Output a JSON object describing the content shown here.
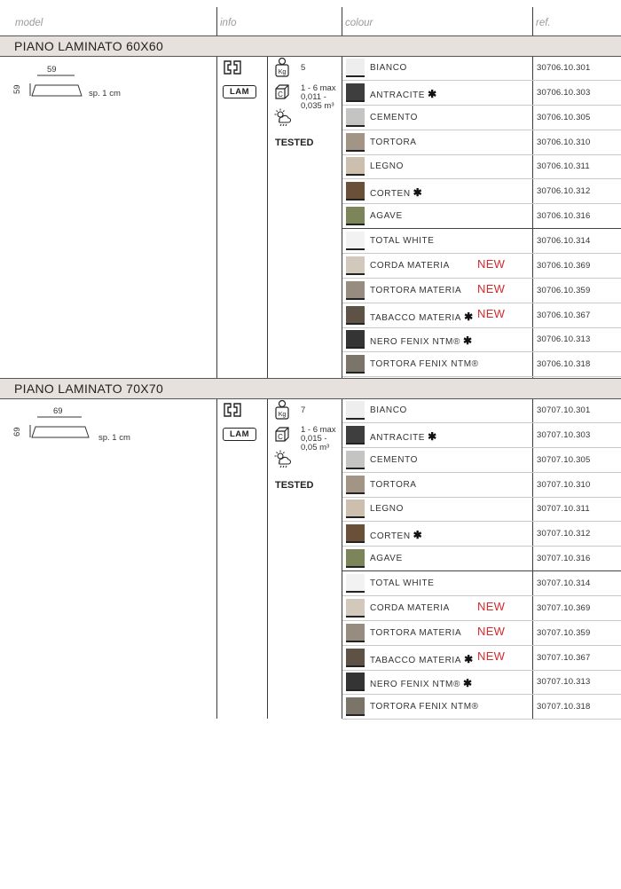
{
  "header": {
    "model": "model",
    "info": "info",
    "colour": "colour",
    "ref": "ref."
  },
  "sections": [
    {
      "title": "PIANO LAMINATO 60X60",
      "dim_top": "59",
      "dim_side": "59",
      "thickness": "sp. 1 cm",
      "lam": "LAM",
      "weight": "5",
      "capacity": [
        "1 - 6 max",
        "0,011 -",
        "0,035 m³"
      ],
      "tested": "TESTED",
      "colors": [
        {
          "name": "BIANCO",
          "star": "",
          "new": "",
          "ref": "30706.10.301",
          "color": "#eeeeee"
        },
        {
          "name": "ANTRACITE",
          "star": "✱",
          "new": "",
          "ref": "30706.10.303",
          "color": "#3e3e3e"
        },
        {
          "name": "CEMENTO",
          "star": "",
          "new": "",
          "ref": "30706.10.305",
          "color": "#c4c4c2"
        },
        {
          "name": "TORTORA",
          "star": "",
          "new": "",
          "ref": "30706.10.310",
          "color": "#a39585"
        },
        {
          "name": "LEGNO",
          "star": "",
          "new": "",
          "ref": "30706.10.311",
          "color": "#cdbfae"
        },
        {
          "name": "CORTEN",
          "star": "✱",
          "new": "",
          "ref": "30706.10.312",
          "color": "#6a5038"
        },
        {
          "name": "AGAVE",
          "star": "",
          "new": "",
          "ref": "30706.10.316",
          "color": "#7c8459"
        },
        {
          "name": "TOTAL WHITE",
          "star": "",
          "new": "",
          "ref": "30706.10.314",
          "color": "#f2f2f2"
        },
        {
          "name": "CORDA MATERIA",
          "star": "",
          "new": "NEW",
          "ref": "30706.10.369",
          "color": "#d3c8bc"
        },
        {
          "name": "TORTORA MATERIA",
          "star": "",
          "new": "NEW",
          "ref": "30706.10.359",
          "color": "#978c80"
        },
        {
          "name": "TABACCO MATERIA",
          "star": "✱",
          "new": "NEW",
          "ref": "30706.10.367",
          "color": "#5e5146"
        },
        {
          "name": "NERO FENIX NTM®",
          "star": "✱",
          "new": "",
          "ref": "30706.10.313",
          "color": "#343434"
        },
        {
          "name": "TORTORA FENIX NTM®",
          "star": "",
          "new": "",
          "ref": "30706.10.318",
          "color": "#7b7468"
        }
      ]
    },
    {
      "title": "PIANO LAMINATO 70X70",
      "dim_top": "69",
      "dim_side": "69",
      "thickness": "sp. 1 cm",
      "lam": "LAM",
      "weight": "7",
      "capacity": [
        "1 - 6 max",
        "0,015 -",
        "0,05 m³"
      ],
      "tested": "TESTED",
      "colors": [
        {
          "name": "BIANCO",
          "star": "",
          "new": "",
          "ref": "30707.10.301",
          "color": "#eeeeee"
        },
        {
          "name": "ANTRACITE",
          "star": "✱",
          "new": "",
          "ref": "30707.10.303",
          "color": "#3e3e3e"
        },
        {
          "name": "CEMENTO",
          "star": "",
          "new": "",
          "ref": "30707.10.305",
          "color": "#c4c4c2"
        },
        {
          "name": "TORTORA",
          "star": "",
          "new": "",
          "ref": "30707.10.310",
          "color": "#a39585"
        },
        {
          "name": "LEGNO",
          "star": "",
          "new": "",
          "ref": "30707.10.311",
          "color": "#cdbfae"
        },
        {
          "name": "CORTEN",
          "star": "✱",
          "new": "",
          "ref": "30707.10.312",
          "color": "#6a5038"
        },
        {
          "name": "AGAVE",
          "star": "",
          "new": "",
          "ref": "30707.10.316",
          "color": "#7c8459"
        },
        {
          "name": "TOTAL WHITE",
          "star": "",
          "new": "",
          "ref": "30707.10.314",
          "color": "#f2f2f2"
        },
        {
          "name": "CORDA MATERIA",
          "star": "",
          "new": "NEW",
          "ref": "30707.10.369",
          "color": "#d3c8bc"
        },
        {
          "name": "TORTORA MATERIA",
          "star": "",
          "new": "NEW",
          "ref": "30707.10.359",
          "color": "#978c80"
        },
        {
          "name": "TABACCO MATERIA",
          "star": "✱",
          "new": "NEW",
          "ref": "30707.10.367",
          "color": "#5e5146"
        },
        {
          "name": "NERO FENIX NTM®",
          "star": "✱",
          "new": "",
          "ref": "30707.10.313",
          "color": "#343434"
        },
        {
          "name": "TORTORA FENIX NTM®",
          "star": "",
          "new": "",
          "ref": "30707.10.318",
          "color": "#7b7468"
        }
      ]
    }
  ]
}
